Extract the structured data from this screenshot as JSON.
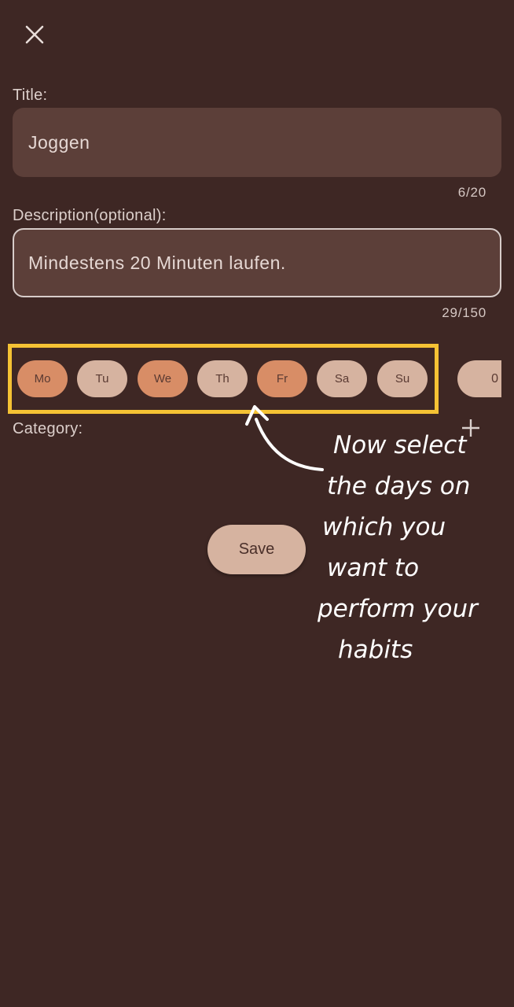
{
  "header": {
    "close_icon": "close-icon"
  },
  "title_field": {
    "label": "Title:",
    "value": "Joggen",
    "counter": "6/20"
  },
  "description_field": {
    "label": "Description(optional):",
    "value": "Mindestens 20 Minuten laufen.",
    "counter": "29/150"
  },
  "days": [
    {
      "label": "Mo",
      "selected": true
    },
    {
      "label": "Tu",
      "selected": false
    },
    {
      "label": "We",
      "selected": true
    },
    {
      "label": "Th",
      "selected": false
    },
    {
      "label": "Fr",
      "selected": true
    },
    {
      "label": "Sa",
      "selected": false
    },
    {
      "label": "Su",
      "selected": false
    }
  ],
  "partial_chip": {
    "label": "0"
  },
  "category": {
    "label": "Category:",
    "add_icon": "plus-icon"
  },
  "save_button": {
    "label": "Save"
  },
  "annotation": {
    "lines": [
      "Now select",
      "the days on",
      "which you",
      "want to",
      "perform your",
      "habits"
    ],
    "highlight_color": "#f5c234"
  },
  "colors": {
    "background": "#3e2724",
    "field": "#5c3f39",
    "chip_selected": "#d88d66",
    "chip_unselected": "#d6b3a0"
  }
}
